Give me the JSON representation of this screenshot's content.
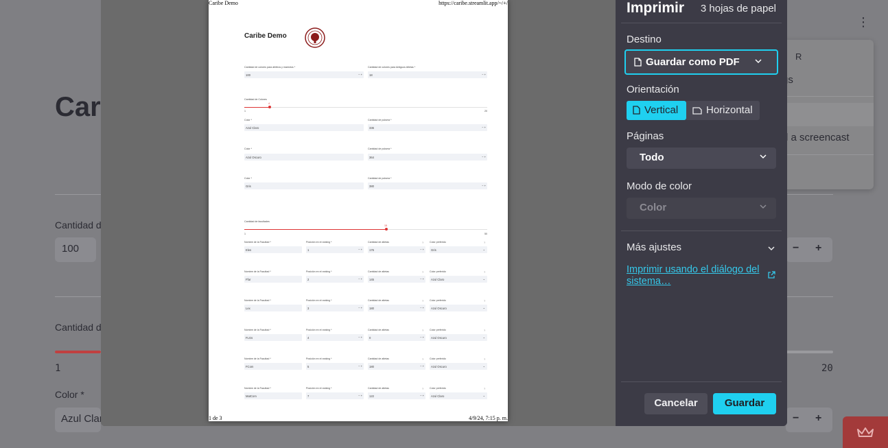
{
  "background": {
    "title": "Car",
    "label_cantidad_1": "Cantidad de",
    "input_value_1": "100",
    "label_cantidad_2": "Cantidad de",
    "slider_min": "1",
    "slider_max": "20",
    "label_color": "Color *",
    "input_color": "Azul Clar",
    "menu_item_1": "R",
    "menu_item_2": "gs",
    "menu_item_3": "d a screencast"
  },
  "dialog": {
    "title": "Imprimir",
    "sheets": "3 hojas de papel",
    "destino_label": "Destino",
    "destino_value": "Guardar como PDF",
    "orientacion_label": "Orientación",
    "orientacion_vertical": "Vertical",
    "orientacion_horizontal": "Horizontal",
    "paginas_label": "Páginas",
    "paginas_value": "Todo",
    "modo_color_label": "Modo de color",
    "modo_color_value": "Color",
    "mas_ajustes": "Más ajustes",
    "system_dialog_link": "Imprimir usando el diálogo del sistema…",
    "cancel": "Cancelar",
    "save": "Guardar"
  },
  "preview": {
    "header_left": "Caribe Demo",
    "header_right": "https://caribe.streamlit.app/~/+/",
    "footer_left": "1 de 3",
    "footer_right": "4/9/24, 7:15 p. m.",
    "page_title": "Caribe Demo",
    "lbl_colores_adultos": "Cantidad de colores para árbitros y maestros *",
    "val_colores_adultos": "100",
    "lbl_colores_antiguos": "Cantidad de colores para Antiguos Atletas *",
    "val_colores_antiguos": "18",
    "lbl_cantidad_colores": "Cantidad de Colores",
    "slider1_value": "4",
    "slider1_min": "1",
    "slider1_max": "20",
    "color_rows": [
      {
        "color_label": "Color *",
        "color": "Azul Claro",
        "count_label": "Cantidad de pulsera *",
        "count": "336"
      },
      {
        "color_label": "Color *",
        "color": "Azul Oscuro",
        "count_label": "Cantidad de pulsera *",
        "count": "364"
      },
      {
        "color_label": "Color *",
        "color": "Gris",
        "count_label": "Cantidad de pulsera *",
        "count": "380"
      }
    ],
    "lbl_cantidad_facultades": "Cantidad de facultades",
    "slider2_value": "15",
    "slider2_min": "1",
    "slider2_max": "50",
    "faculty_rows": [
      {
        "name_label": "Nombre de la Facultad *",
        "name": "Eles",
        "rank_label": "Posición en el ranking *",
        "rank": "1",
        "athletes_label": "Cantidad de atletas",
        "athletes": "176",
        "color_label": "Color preferido",
        "color": "Gris"
      },
      {
        "name_label": "Nombre de la Facultad *",
        "name": "Ffar",
        "rank_label": "Posición en el ranking *",
        "rank": "2",
        "athletes_label": "Cantidad de atletas",
        "athletes": "145",
        "color_label": "Color preferido",
        "color": "Azul Claro"
      },
      {
        "name_label": "Nombre de la Facultad *",
        "name": "Lex",
        "rank_label": "Posición en el ranking *",
        "rank": "3",
        "athletes_label": "Cantidad de atletas",
        "athletes": "180",
        "color_label": "Color preferido",
        "color": "Azul Oscuro"
      },
      {
        "name_label": "Nombre de la Facultad *",
        "name": "FLGs",
        "rank_label": "Posición en el ranking *",
        "rank": "4",
        "athletes_label": "Cantidad de atletas",
        "athletes": "0",
        "color_label": "Color preferido",
        "color": "Azul Oscuro"
      },
      {
        "name_label": "Nombre de la Facultad *",
        "name": "FCom",
        "rank_label": "Posición en el ranking *",
        "rank": "5",
        "athletes_label": "Cantidad de atletas",
        "athletes": "180",
        "color_label": "Color preferido",
        "color": "Azul Oscuro"
      },
      {
        "name_label": "Nombre de la Facultad *",
        "name": "MatCom",
        "rank_label": "Posición en el ranking *",
        "rank": "7",
        "athletes_label": "Cantidad de atletas",
        "athletes": "122",
        "color_label": "Color preferido",
        "color": "Azul Claro"
      }
    ]
  }
}
